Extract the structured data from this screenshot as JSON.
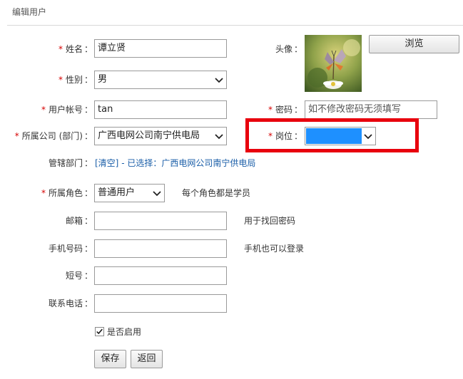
{
  "page": {
    "title": "编辑用户"
  },
  "form": {
    "name": {
      "label": "姓名",
      "value": "谭立贤",
      "required": true
    },
    "gender": {
      "label": "性别",
      "value": "男",
      "required": true
    },
    "account": {
      "label": "用户帐号",
      "value": "tan",
      "required": true
    },
    "company": {
      "label": "所属公司 (部门)",
      "value": "广西电网公司南宁供电局",
      "required": true
    },
    "managed_dept": {
      "label": "管辖部门",
      "clear_link": "[清空]",
      "selected_text": "- 已选择：广西电网公司南宁供电局"
    },
    "role": {
      "label": "所属角色",
      "value": "普通用户",
      "hint": "每个角色都是学员",
      "required": true
    },
    "email": {
      "label": "邮箱",
      "value": "",
      "hint": "用于找回密码"
    },
    "mobile": {
      "label": "手机号码",
      "value": "",
      "hint": "手机也可以登录"
    },
    "short_no": {
      "label": "短号",
      "value": ""
    },
    "phone": {
      "label": "联系电话",
      "value": ""
    },
    "enabled": {
      "label": "是否启用",
      "checked": true
    },
    "avatar": {
      "label": "头像",
      "browse_button": "浏览",
      "image_icon": "butterfly-on-flower-photo"
    },
    "password": {
      "label": "密码",
      "placeholder": "如不修改密码无须填写",
      "required": true
    },
    "position": {
      "label": "岗位",
      "value": "",
      "required": true,
      "highlight_color": "#1e90ff"
    }
  },
  "buttons": {
    "save": "保存",
    "back": "返回"
  },
  "colors": {
    "required_star": "#d60000",
    "link": "#1a5ea8",
    "annotation_box": "#e8000d"
  }
}
